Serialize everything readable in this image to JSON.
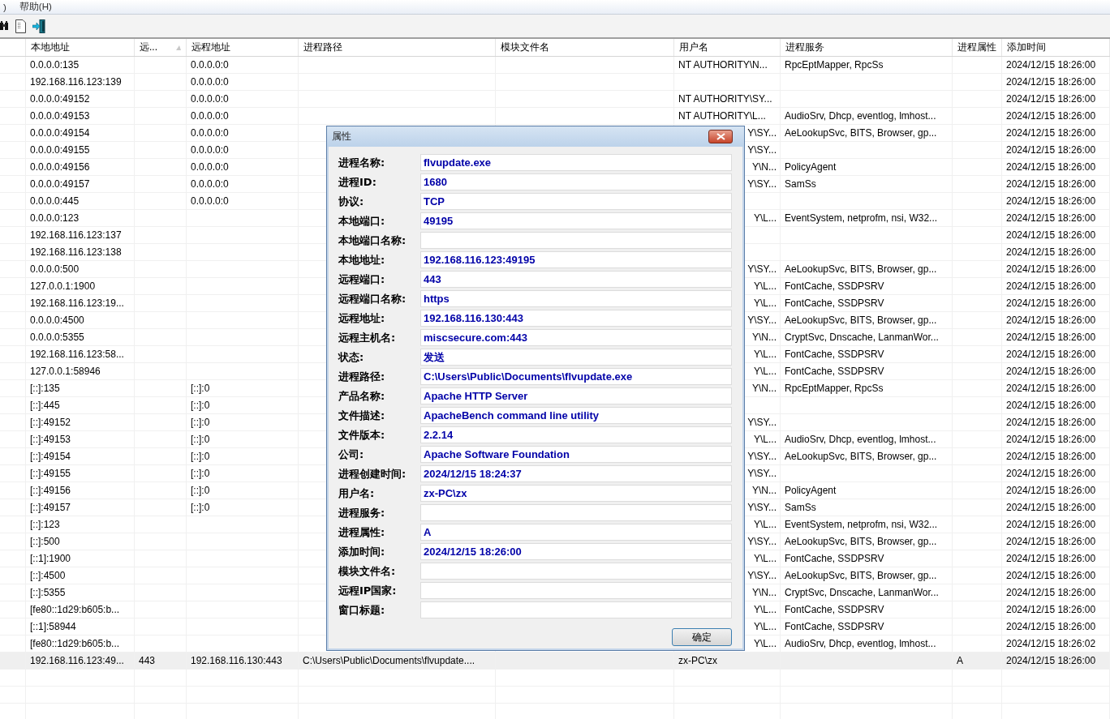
{
  "menu": [
    ")",
    "帮助(H)"
  ],
  "table": {
    "columns": [
      {
        "label": "本地地址",
        "sorted": false
      },
      {
        "label": "远...",
        "sorted": true
      },
      {
        "label": "远程地址",
        "sorted": false
      },
      {
        "label": "进程路径",
        "sorted": false
      },
      {
        "label": "模块文件名",
        "sorted": false
      },
      {
        "label": "用户名",
        "sorted": false
      },
      {
        "label": "进程服务",
        "sorted": false
      },
      {
        "label": "进程属性",
        "sorted": false
      },
      {
        "label": "添加时间",
        "sorted": false
      }
    ],
    "rows": [
      {
        "local_address": "0.0.0.0:135",
        "remote_address": "0.0.0.0:0",
        "user": "NT AUTHORITY\\N...",
        "services": "RpcEptMapper, RpcSs",
        "added_time": "2024/12/15 18:26:00",
        "selected": false
      },
      {
        "local_address": "192.168.116.123:139",
        "remote_address": "0.0.0.0:0",
        "added_time": "2024/12/15 18:26:00",
        "selected": false
      },
      {
        "local_address": "0.0.0.0:49152",
        "remote_address": "0.0.0.0:0",
        "user": "NT AUTHORITY\\SY...",
        "added_time": "2024/12/15 18:26:00",
        "selected": false
      },
      {
        "local_address": "0.0.0.0:49153",
        "remote_address": "0.0.0.0:0",
        "user": "NT AUTHORITY\\L...",
        "services": "AudioSrv, Dhcp, eventlog, lmhost...",
        "added_time": "2024/12/15 18:26:00",
        "selected": false
      },
      {
        "local_address": "0.0.0.0:49154",
        "remote_address": "0.0.0.0:0",
        "user": "Y\\SY...",
        "services": "AeLookupSvc, BITS, Browser, gp...",
        "added_time": "2024/12/15 18:26:00",
        "selected": false
      },
      {
        "local_address": "0.0.0.0:49155",
        "remote_address": "0.0.0.0:0",
        "user": "Y\\SY...",
        "added_time": "2024/12/15 18:26:00",
        "selected": false
      },
      {
        "local_address": "0.0.0.0:49156",
        "remote_address": "0.0.0.0:0",
        "user": "Y\\N...",
        "services": "PolicyAgent",
        "added_time": "2024/12/15 18:26:00",
        "selected": false
      },
      {
        "local_address": "0.0.0.0:49157",
        "remote_address": "0.0.0.0:0",
        "user": "Y\\SY...",
        "services": "SamSs",
        "added_time": "2024/12/15 18:26:00",
        "selected": false
      },
      {
        "local_address": "0.0.0.0:445",
        "remote_address": "0.0.0.0:0",
        "added_time": "2024/12/15 18:26:00",
        "selected": false
      },
      {
        "local_address": "0.0.0.0:123",
        "user": "Y\\L...",
        "services": "EventSystem, netprofm, nsi, W32...",
        "added_time": "2024/12/15 18:26:00",
        "selected": false
      },
      {
        "local_address": "192.168.116.123:137",
        "added_time": "2024/12/15 18:26:00",
        "selected": false
      },
      {
        "local_address": "192.168.116.123:138",
        "added_time": "2024/12/15 18:26:00",
        "selected": false
      },
      {
        "local_address": "0.0.0.0:500",
        "user": "Y\\SY...",
        "services": "AeLookupSvc, BITS, Browser, gp...",
        "added_time": "2024/12/15 18:26:00",
        "selected": false
      },
      {
        "local_address": "127.0.0.1:1900",
        "user": "Y\\L...",
        "services": "FontCache, SSDPSRV",
        "added_time": "2024/12/15 18:26:00",
        "selected": false
      },
      {
        "local_address": "192.168.116.123:19...",
        "user": "Y\\L...",
        "services": "FontCache, SSDPSRV",
        "added_time": "2024/12/15 18:26:00",
        "selected": false
      },
      {
        "local_address": "0.0.0.0:4500",
        "user": "Y\\SY...",
        "services": "AeLookupSvc, BITS, Browser, gp...",
        "added_time": "2024/12/15 18:26:00",
        "selected": false
      },
      {
        "local_address": "0.0.0.0:5355",
        "user": "Y\\N...",
        "services": "CryptSvc, Dnscache, LanmanWor...",
        "added_time": "2024/12/15 18:26:00",
        "selected": false
      },
      {
        "local_address": "192.168.116.123:58...",
        "user": "Y\\L...",
        "services": "FontCache, SSDPSRV",
        "added_time": "2024/12/15 18:26:00",
        "selected": false
      },
      {
        "local_address": "127.0.0.1:58946",
        "user": "Y\\L...",
        "services": "FontCache, SSDPSRV",
        "added_time": "2024/12/15 18:26:00",
        "selected": false
      },
      {
        "local_address": "[::]:135",
        "remote_address": "[::]:0",
        "user": "Y\\N...",
        "services": "RpcEptMapper, RpcSs",
        "added_time": "2024/12/15 18:26:00",
        "selected": false
      },
      {
        "local_address": "[::]:445",
        "remote_address": "[::]:0",
        "added_time": "2024/12/15 18:26:00",
        "selected": false
      },
      {
        "local_address": "[::]:49152",
        "remote_address": "[::]:0",
        "user": "Y\\SY...",
        "added_time": "2024/12/15 18:26:00",
        "selected": false
      },
      {
        "local_address": "[::]:49153",
        "remote_address": "[::]:0",
        "user": "Y\\L...",
        "services": "AudioSrv, Dhcp, eventlog, lmhost...",
        "added_time": "2024/12/15 18:26:00",
        "selected": false
      },
      {
        "local_address": "[::]:49154",
        "remote_address": "[::]:0",
        "user": "Y\\SY...",
        "services": "AeLookupSvc, BITS, Browser, gp...",
        "added_time": "2024/12/15 18:26:00",
        "selected": false
      },
      {
        "local_address": "[::]:49155",
        "remote_address": "[::]:0",
        "user": "Y\\SY...",
        "added_time": "2024/12/15 18:26:00",
        "selected": false
      },
      {
        "local_address": "[::]:49156",
        "remote_address": "[::]:0",
        "user": "Y\\N...",
        "services": "PolicyAgent",
        "added_time": "2024/12/15 18:26:00",
        "selected": false
      },
      {
        "local_address": "[::]:49157",
        "remote_address": "[::]:0",
        "user": "Y\\SY...",
        "services": "SamSs",
        "added_time": "2024/12/15 18:26:00",
        "selected": false
      },
      {
        "local_address": "[::]:123",
        "user": "Y\\L...",
        "services": "EventSystem, netprofm, nsi, W32...",
        "added_time": "2024/12/15 18:26:00",
        "selected": false
      },
      {
        "local_address": "[::]:500",
        "user": "Y\\SY...",
        "services": "AeLookupSvc, BITS, Browser, gp...",
        "added_time": "2024/12/15 18:26:00",
        "selected": false
      },
      {
        "local_address": "[::1]:1900",
        "user": "Y\\L...",
        "services": "FontCache, SSDPSRV",
        "added_time": "2024/12/15 18:26:00",
        "selected": false
      },
      {
        "local_address": "[::]:4500",
        "user": "Y\\SY...",
        "services": "AeLookupSvc, BITS, Browser, gp...",
        "added_time": "2024/12/15 18:26:00",
        "selected": false
      },
      {
        "local_address": "[::]:5355",
        "user": "Y\\N...",
        "services": "CryptSvc, Dnscache, LanmanWor...",
        "added_time": "2024/12/15 18:26:00",
        "selected": false
      },
      {
        "local_address": "[fe80::1d29:b605:b...",
        "user": "Y\\L...",
        "services": "FontCache, SSDPSRV",
        "added_time": "2024/12/15 18:26:00",
        "selected": false
      },
      {
        "local_address": "[::1]:58944",
        "user": "Y\\L...",
        "services": "FontCache, SSDPSRV",
        "added_time": "2024/12/15 18:26:00",
        "selected": false
      },
      {
        "local_address": "[fe80::1d29:b605:b...",
        "user": "Y\\L...",
        "services": "AudioSrv, Dhcp, eventlog, lmhost...",
        "added_time": "2024/12/15 18:26:02",
        "selected": false
      },
      {
        "local_address": "192.168.116.123:49...",
        "remote_port": "443",
        "remote_address": "192.168.116.130:443",
        "process_path": "C:\\Users\\Public\\Documents\\flvupdate....",
        "user": "zx-PC\\zx",
        "attributes": "A",
        "added_time": "2024/12/15 18:26:00",
        "selected": true
      }
    ]
  },
  "dialog": {
    "title": "属性",
    "fields": [
      {
        "label": "进程名称:",
        "value": "flvupdate.exe"
      },
      {
        "label": "进程ID:",
        "value": "1680"
      },
      {
        "label": "协议:",
        "value": "TCP"
      },
      {
        "label": "本地端口:",
        "value": "49195"
      },
      {
        "label": "本地端口名称:"
      },
      {
        "label": "本地地址:",
        "value": "192.168.116.123:49195"
      },
      {
        "label": "远程端口:",
        "value": "443"
      },
      {
        "label": "远程端口名称:",
        "value": "https"
      },
      {
        "label": "远程地址:",
        "value": "192.168.116.130:443"
      },
      {
        "label": "远程主机名:",
        "value": "miscsecure.com:443"
      },
      {
        "label": "状态:",
        "value": "发送"
      },
      {
        "label": "进程路径:",
        "value": "C:\\Users\\Public\\Documents\\flvupdate.exe"
      },
      {
        "label": "产品名称:",
        "value": "Apache HTTP Server"
      },
      {
        "label": "文件描述:",
        "value": "ApacheBench command line utility"
      },
      {
        "label": "文件版本:",
        "value": "2.2.14"
      },
      {
        "label": "公司:",
        "value": "Apache Software Foundation"
      },
      {
        "label": "进程创建时间:",
        "value": "2024/12/15 18:24:37"
      },
      {
        "label": "用户名:",
        "value": "zx-PC\\zx"
      },
      {
        "label": "进程服务:"
      },
      {
        "label": "进程属性:",
        "value": "A"
      },
      {
        "label": "添加时间:",
        "value": "2024/12/15 18:26:00"
      },
      {
        "label": "模块文件名:"
      },
      {
        "label": "远程IP国家:"
      },
      {
        "label": "窗口标题:"
      }
    ],
    "ok_button": "确定"
  }
}
